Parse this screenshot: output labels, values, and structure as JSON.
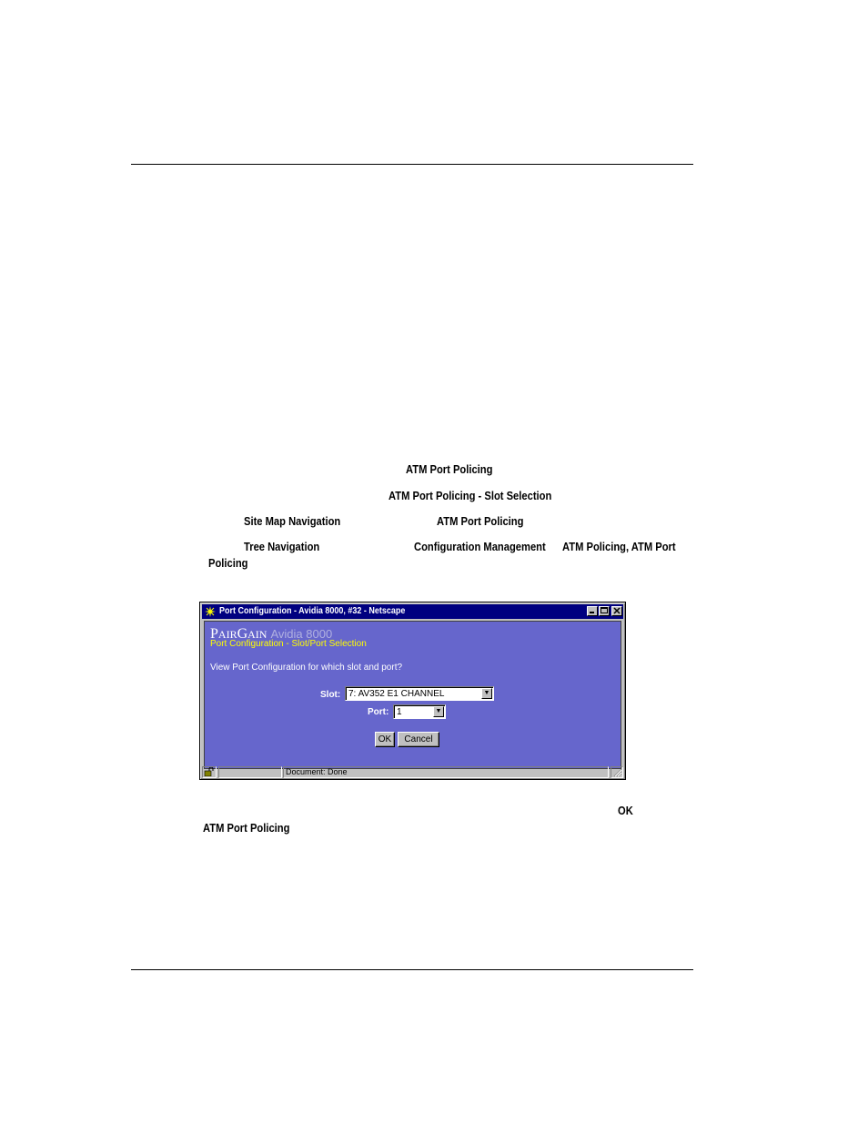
{
  "instructions": {
    "step1_term": "ATM Port Policing",
    "step2_term": "ATM Port Policing - Slot Selection",
    "sitemap_term": "Site Map Navigation",
    "sitemap_target": "ATM Port Policing",
    "tree_term": "Tree Navigation",
    "tree_path1": "Configuration Management",
    "tree_path2": "ATM Policing, ATM Port",
    "tree_path3": "Policing",
    "ok_term": "OK",
    "result_term": "ATM Port Policing"
  },
  "window": {
    "title": "Port Configuration - Avidia 8000, #32 - Netscape",
    "brand_first_cap": "P",
    "brand_first_rest": "AIR",
    "brand_second_cap": "G",
    "brand_second_rest": "AIN",
    "brand_model": "Avidia 8000",
    "subtitle": "Port Configuration - Slot/Port Selection",
    "question": "View Port Configuration for which slot and port?",
    "slot_label": "Slot:",
    "slot_value": "7: AV352 E1 CHANNEL",
    "port_label": "Port:",
    "port_value": "1",
    "ok_label": "OK",
    "cancel_label": "Cancel",
    "status_text": "Document: Done"
  }
}
